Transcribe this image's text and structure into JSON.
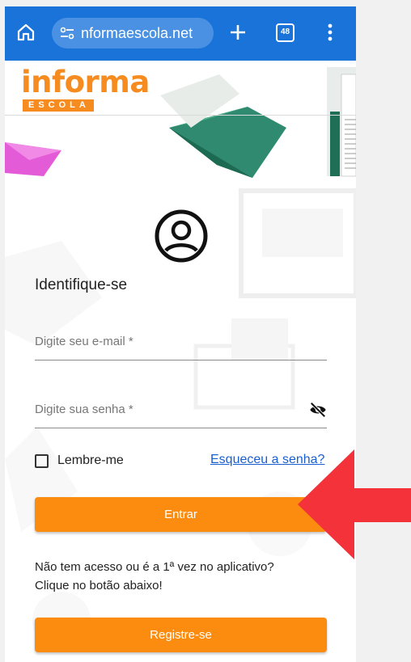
{
  "browser": {
    "url": "nformaescola.net",
    "tab_count": "48"
  },
  "site": {
    "logo_text": "informa",
    "logo_badge": "ESCOLA"
  },
  "form": {
    "title": "Identifique-se",
    "email_placeholder": "Digite seu e-mail *",
    "password_placeholder": "Digite sua senha *",
    "remember_label": "Lembre-me",
    "forgot_link": "Esqueceu a senha?",
    "enter_button": "Entrar",
    "info_line1": "Não tem acesso ou é a 1ª vez no aplicativo?",
    "info_line2": "Clique no botão abaixo!",
    "register_button": "Registre-se"
  },
  "colors": {
    "browser_bar": "#1a73d9",
    "brand_orange": "#f68c1f",
    "button_orange": "#fb8c0f",
    "link_blue": "#1a5fd0",
    "arrow_red": "#f4323a"
  }
}
